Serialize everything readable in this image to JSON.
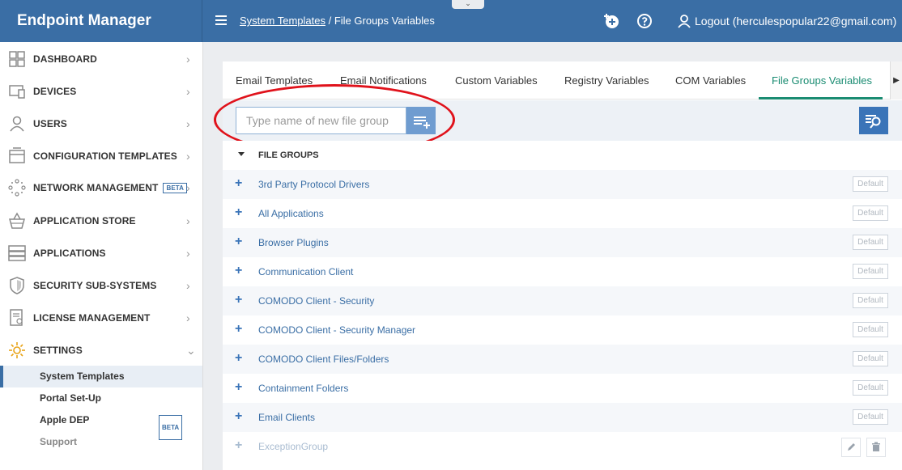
{
  "header": {
    "brand": "Endpoint Manager",
    "breadcrumb_link": "System Templates",
    "breadcrumb_sep": "/",
    "breadcrumb_current": "File Groups Variables",
    "collapse_glyph": "⌄",
    "logout_label": "Logout (herculespopular22@gmail.com)",
    "icons": [
      "add-circle-icon",
      "help-icon",
      "user-icon"
    ]
  },
  "sidebar": {
    "items": [
      {
        "label": "DASHBOARD",
        "icon": "dashboard-icon",
        "chevron": "›"
      },
      {
        "label": "DEVICES",
        "icon": "devices-icon",
        "chevron": "›"
      },
      {
        "label": "USERS",
        "icon": "user-icon",
        "chevron": "›"
      },
      {
        "label": "CONFIGURATION TEMPLATES",
        "icon": "templates-icon",
        "chevron": "›"
      },
      {
        "label": "NETWORK MANAGEMENT",
        "icon": "network-icon",
        "badge": "BETA",
        "chevron": "›"
      },
      {
        "label": "APPLICATION STORE",
        "icon": "store-basket-icon",
        "chevron": "›"
      },
      {
        "label": "APPLICATIONS",
        "icon": "applications-icon",
        "chevron": "›"
      },
      {
        "label": "SECURITY SUB-SYSTEMS",
        "icon": "shield-icon",
        "chevron": "›"
      },
      {
        "label": "LICENSE MANAGEMENT",
        "icon": "license-icon",
        "chevron": "›"
      },
      {
        "label": "SETTINGS",
        "icon": "gear-icon",
        "chevron": "⌄"
      }
    ],
    "sub_items": [
      {
        "label": "System Templates"
      },
      {
        "label": "Portal Set-Up"
      },
      {
        "label": "Apple DEP",
        "badge": "BETA"
      },
      {
        "label": "Support"
      }
    ]
  },
  "tabs": [
    {
      "label": "Email Templates"
    },
    {
      "label": "Email Notifications"
    },
    {
      "label": "Custom Variables"
    },
    {
      "label": "Registry Variables"
    },
    {
      "label": "COM Variables"
    },
    {
      "label": "File Groups Variables"
    }
  ],
  "tab_more_glyph": "▶",
  "toolbar": {
    "input_placeholder": "Type name of new file group",
    "input_value": ""
  },
  "file_groups": {
    "title": "FILE GROUPS",
    "default_label": "Default",
    "rows": [
      {
        "name": "3rd Party Protocol Drivers"
      },
      {
        "name": "All Applications"
      },
      {
        "name": "Browser Plugins"
      },
      {
        "name": "Communication Client"
      },
      {
        "name": "COMODO Client - Security"
      },
      {
        "name": "COMODO Client - Security Manager"
      },
      {
        "name": "COMODO Client Files/Folders"
      },
      {
        "name": "Containment Folders"
      },
      {
        "name": "Email Clients"
      },
      {
        "name": "ExceptionGroup"
      }
    ]
  },
  "colors": {
    "header_bg": "#3a6ea5",
    "active_tab": "#1a8c72",
    "link": "#3a6ea5",
    "highlight": "#e0121b"
  }
}
